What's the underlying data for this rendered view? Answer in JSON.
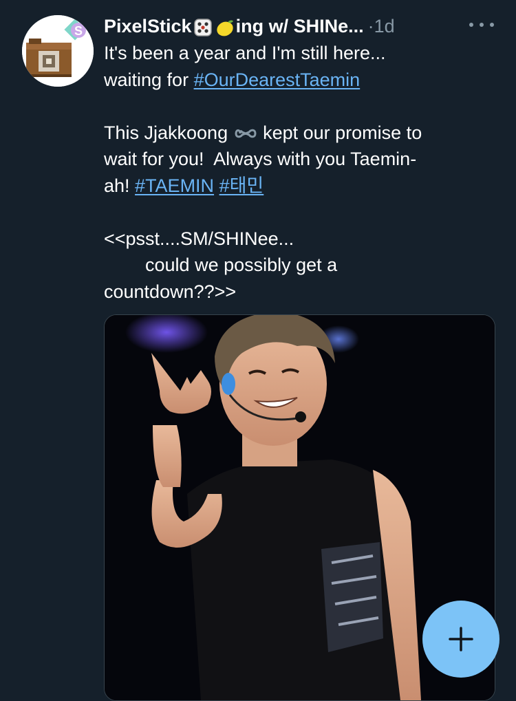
{
  "tweet": {
    "author_name_start": "PixelStick",
    "author_name_end": "ing w/ SHINe...",
    "separator": "·",
    "time": "1d",
    "line1": "It's been a year and I'm still here...",
    "line2_prefix": "waiting for ",
    "hashtag_main": "#OurDearestTaemin",
    "para2_line1_a": "This Jjakkoong ",
    "para2_line1_b": " kept our promise to",
    "para2_line2": "wait for you!  Always with you Taemin-",
    "para2_line3_prefix": "ah! ",
    "hashtag_taemin": "#TAEMIN",
    "hashtag_korean": "#태민",
    "para3_line1": "<<psst....SM/SHINee...",
    "para3_line2": "        could we possibly get a",
    "para3_line3": "countdown??>>"
  },
  "icons": {
    "avatar": "camera-avatar-icon",
    "dice": "die-emoji",
    "lemon": "lemon-emoji",
    "infinity": "infinity-emoji",
    "more": "more-options-icon",
    "compose": "plus-icon"
  },
  "colors": {
    "background": "#15202b",
    "link": "#6ab4f5",
    "muted": "#8899a6",
    "fab": "#7cc3f7"
  }
}
